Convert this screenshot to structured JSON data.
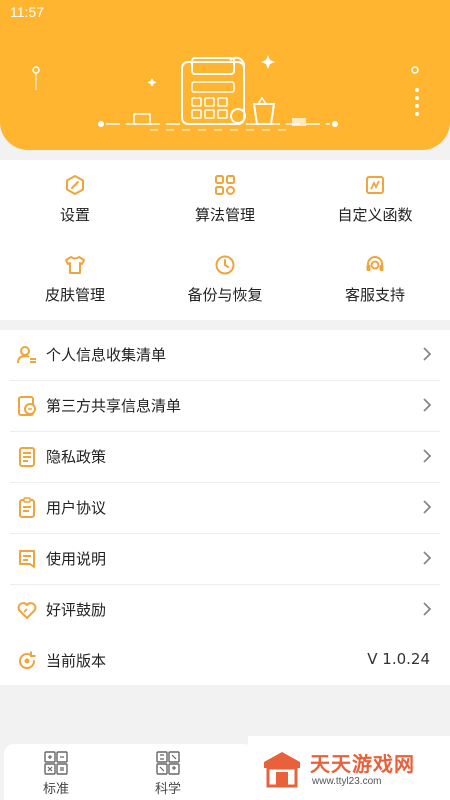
{
  "status_bar": {
    "time": "11:57"
  },
  "colors": {
    "brand": "#ffb52f",
    "icon": "#f0a43c",
    "text": "#222222"
  },
  "features": [
    {
      "label": "设置",
      "icon": "gear-hexagon-icon"
    },
    {
      "label": "算法管理",
      "icon": "algorithm-grid-icon"
    },
    {
      "label": "自定义函数",
      "icon": "custom-function-icon"
    },
    {
      "label": "皮肤管理",
      "icon": "tshirt-icon"
    },
    {
      "label": "备份与恢复",
      "icon": "backup-restore-icon"
    },
    {
      "label": "客服支持",
      "icon": "headset-icon"
    }
  ],
  "menu": [
    {
      "label": "个人信息收集清单",
      "icon": "user-list-icon"
    },
    {
      "label": "第三方共享信息清单",
      "icon": "share-list-icon"
    },
    {
      "label": "隐私政策",
      "icon": "document-icon"
    },
    {
      "label": "用户协议",
      "icon": "agreement-icon"
    },
    {
      "label": "使用说明",
      "icon": "manual-icon"
    },
    {
      "label": "好评鼓励",
      "icon": "heart-icon"
    }
  ],
  "version": {
    "label": "当前版本",
    "value": "V 1.0.24",
    "icon": "refresh-icon"
  },
  "tabs": [
    {
      "label": "标准",
      "icon": "standard-calculator-icon"
    },
    {
      "label": "科学",
      "icon": "scientific-calculator-icon"
    }
  ],
  "watermark": {
    "title": "天天游戏网",
    "url": "www.ttyl23.com"
  }
}
